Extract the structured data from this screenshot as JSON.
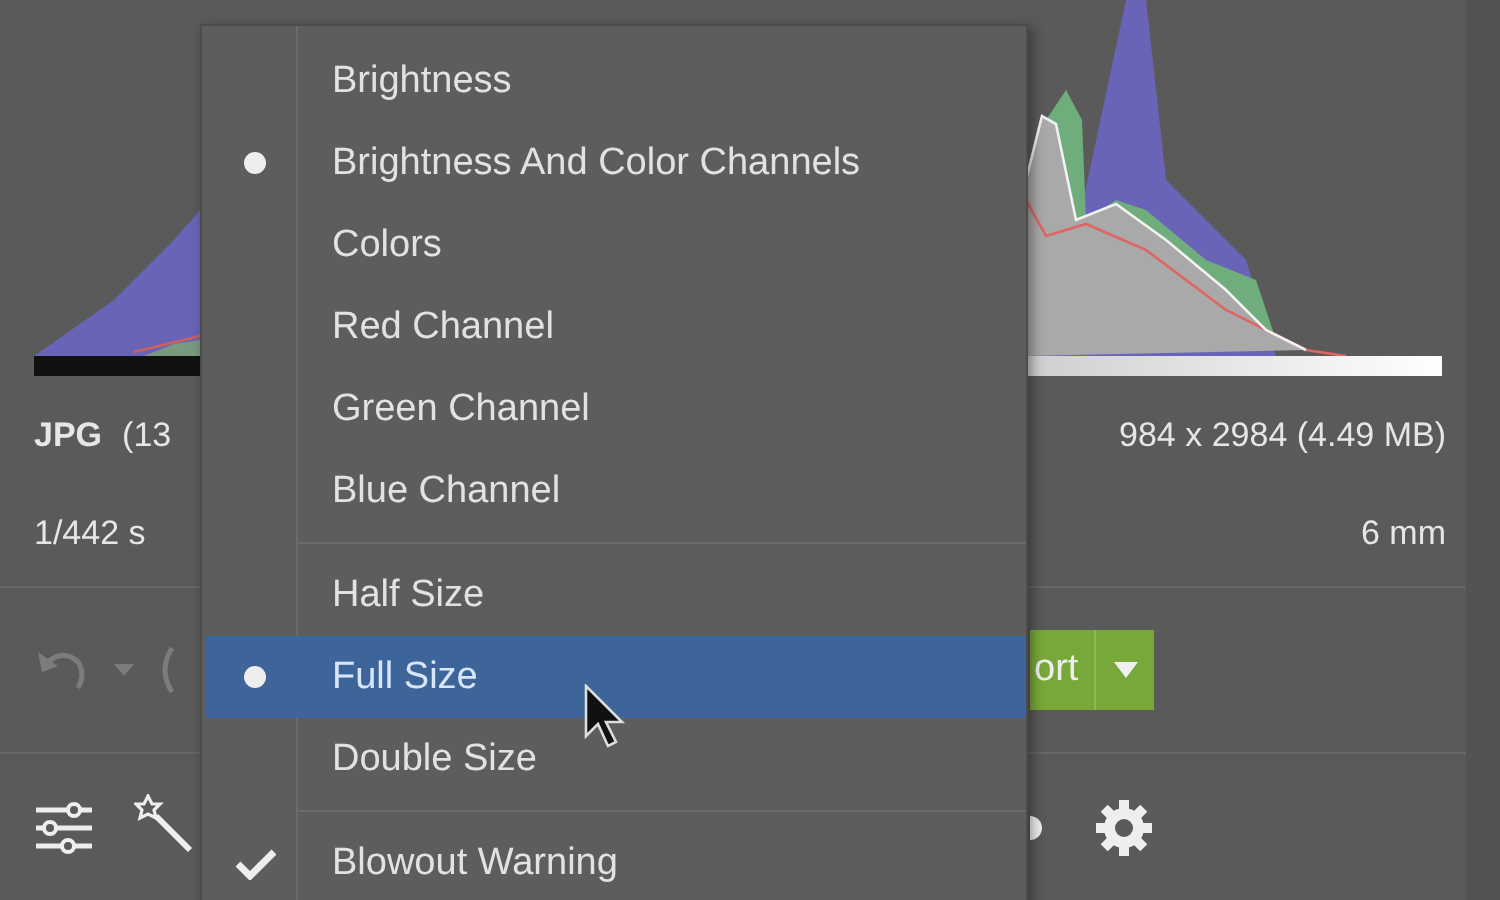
{
  "file_info": {
    "format": "JPG",
    "size": "(13",
    "dimensions": "984 x 2984 (4.49 MB)"
  },
  "exposure": {
    "shutter": "1/442 s",
    "focal_length": "6 mm"
  },
  "toolbar": {
    "export_button": "ort"
  },
  "menu": {
    "sections": [
      {
        "items": [
          {
            "label": "Brightness",
            "kind": "radio",
            "selected": false
          },
          {
            "label": "Brightness And Color Channels",
            "kind": "radio",
            "selected": true
          },
          {
            "label": "Colors",
            "kind": "radio",
            "selected": false
          },
          {
            "label": "Red Channel",
            "kind": "radio",
            "selected": false
          },
          {
            "label": "Green Channel",
            "kind": "radio",
            "selected": false
          },
          {
            "label": "Blue Channel",
            "kind": "radio",
            "selected": false
          }
        ]
      },
      {
        "items": [
          {
            "label": "Half Size",
            "kind": "radio",
            "selected": false,
            "highlighted": false
          },
          {
            "label": "Full Size",
            "kind": "radio",
            "selected": true,
            "highlighted": true
          },
          {
            "label": "Double Size",
            "kind": "radio",
            "selected": false,
            "highlighted": false
          }
        ]
      },
      {
        "items": [
          {
            "label": "Blowout Warning",
            "kind": "check",
            "checked": true
          }
        ]
      }
    ]
  }
}
